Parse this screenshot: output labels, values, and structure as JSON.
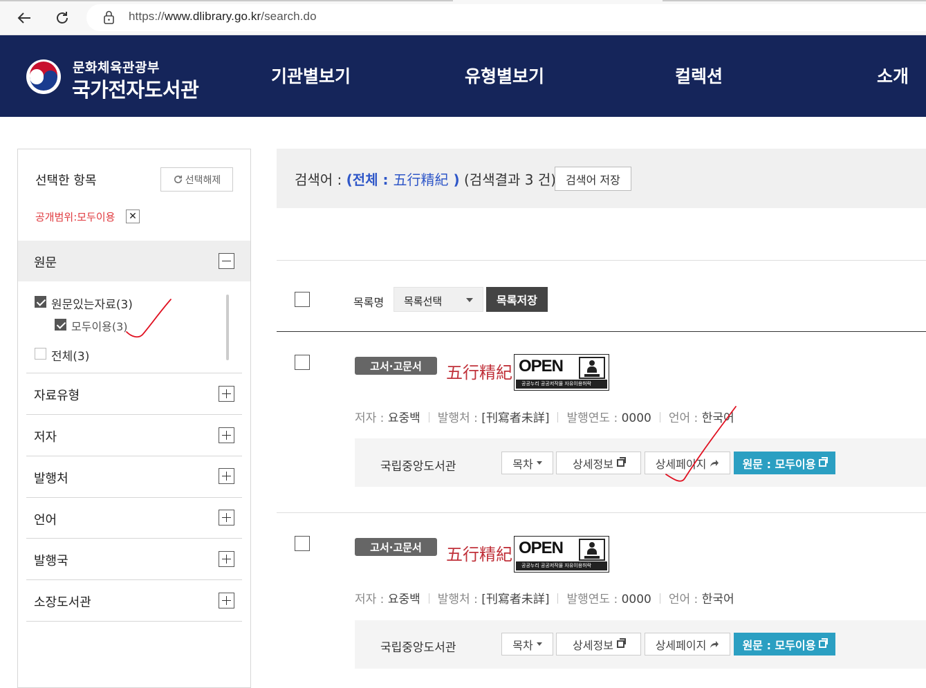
{
  "browser": {
    "url_prefix": "https://",
    "url_domain": "www.dlibrary.go.kr",
    "url_path": "/search.do"
  },
  "header": {
    "ministry": "문화체육관광부",
    "site_name": "국가전자도서관",
    "nav": [
      "기관별보기",
      "유형별보기",
      "컬렉션",
      "소개"
    ]
  },
  "sidebar": {
    "selected_title": "선택한 항목",
    "clear_label": "선택해제",
    "chip_label": "공개범위:모두이용",
    "chip_close": "✕",
    "open_facet": {
      "label": "원문",
      "options": [
        {
          "label": "원문있는자료(3)",
          "checked": true
        },
        {
          "label": "모두이용(3)",
          "checked": true
        },
        {
          "label": "전체(3)",
          "checked": false
        }
      ]
    },
    "facets": [
      "자료유형",
      "저자",
      "발행처",
      "언어",
      "발행국",
      "소장도서관"
    ]
  },
  "search": {
    "prefix": "검색어 : ",
    "open_paren": "(",
    "scope": "전체 : ",
    "keyword": "五行精紀",
    "close_paren": " )",
    "result_count": " (검색결과 3 건)",
    "save_keyword_label": "검색어 저장"
  },
  "list_controls": {
    "label": "목록명",
    "select_value": "목록선택",
    "save_label": "목록저장"
  },
  "results": [
    {
      "badge": "고서·고문서",
      "title": "五行精紀",
      "open_text": "OPEN",
      "open_bar": "공공누리  공공저작물 자유이용허락",
      "meta": [
        {
          "key": "저자 : ",
          "value": "요중백"
        },
        {
          "key": "발행처 : ",
          "value": "[刊寫者未詳]"
        },
        {
          "key": "발행연도 : ",
          "value": "0000"
        },
        {
          "key": "언어 : ",
          "value": "한국어"
        }
      ],
      "holder": "국립중앙도서관",
      "buttons": {
        "toc": "목차",
        "detail": "상세정보",
        "detail_page": "상세페이지",
        "original": "원문 : 모두이용"
      }
    },
    {
      "badge": "고서·고문서",
      "title": "五行精紀",
      "open_text": "OPEN",
      "open_bar": "공공누리  공공저작물 자유이용허락",
      "meta": [
        {
          "key": "저자 : ",
          "value": "요중백"
        },
        {
          "key": "발행처 : ",
          "value": "[刊寫者未詳]"
        },
        {
          "key": "발행연도 : ",
          "value": "0000"
        },
        {
          "key": "언어 : ",
          "value": "한국어"
        }
      ],
      "holder": "국립중앙도서관",
      "buttons": {
        "toc": "목차",
        "detail": "상세정보",
        "detail_page": "상세페이지",
        "original": "원문 : 모두이용"
      }
    }
  ],
  "colors": {
    "header_bg": "#15255a",
    "accent_blue": "#2f57c8",
    "title_red": "#c0313a",
    "primary_button": "#2b9fc2",
    "annotation_red": "#e01020"
  },
  "icons": [
    "back-arrow-icon",
    "reload-icon",
    "lock-icon",
    "refresh-icon",
    "close-icon",
    "minus-icon",
    "plus-icon",
    "checkbox-icon",
    "caret-down-icon",
    "new-window-icon",
    "share-arrow-icon",
    "taegeuk-logo-icon",
    "open-license-logo-icon"
  ]
}
